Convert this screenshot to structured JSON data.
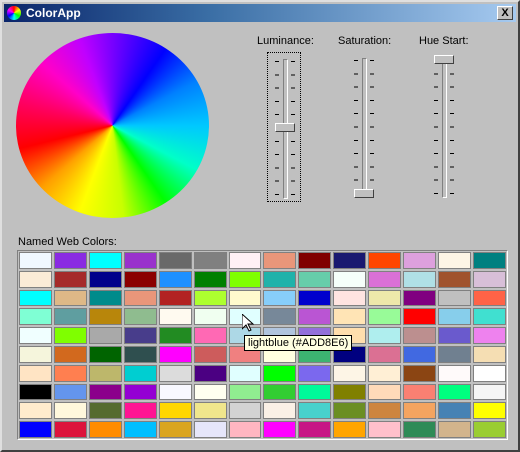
{
  "window": {
    "title": "ColorApp",
    "close_label": "X"
  },
  "sliders": [
    {
      "label": "Luminance:",
      "value": 0.5
    },
    {
      "label": "Saturation:",
      "value": 1.0
    },
    {
      "label": "Hue Start:",
      "value": 0.0
    }
  ],
  "named_colors": {
    "label": "Named Web Colors:",
    "tooltip": "lightblue (#ADD8E6)",
    "swatches": [
      "#f0f8ff",
      "#8a2be2",
      "#00ffff",
      "#9932cc",
      "#696969",
      "#808080",
      "#fff0f5",
      "#e9967a",
      "#800000",
      "#191970",
      "#ff4500",
      "#dda0dd",
      "#fdf5e6",
      "#008080",
      "#faebd7",
      "#a52a2a",
      "#00008b",
      "#8b0000",
      "#1e90ff",
      "#008000",
      "#7fff00",
      "#20b2aa",
      "#66cdaa",
      "#f5fffa",
      "#da70d6",
      "#b0e0e6",
      "#a0522d",
      "#d8bfd8",
      "#00ffff",
      "#deb887",
      "#008b8b",
      "#e9967a",
      "#b22222",
      "#adff2f",
      "#fffacd",
      "#87cefa",
      "#0000cd",
      "#ffe4e1",
      "#eee8aa",
      "#800080",
      "#c0c0c0",
      "#ff6347",
      "#7fffd4",
      "#5f9ea0",
      "#b8860b",
      "#8fbc8f",
      "#fffaf0",
      "#f0fff0",
      "#e0ffff",
      "#778899",
      "#ba55d3",
      "#ffe4b5",
      "#98fb98",
      "#ff0000",
      "#87ceeb",
      "#40e0d0",
      "#f0ffff",
      "#7fff00",
      "#a9a9a9",
      "#483d8b",
      "#228b22",
      "#ff69b4",
      "#add8e6",
      "#b0c4de",
      "#9370db",
      "#ffdead",
      "#afeeee",
      "#bc8f8f",
      "#6a5acd",
      "#ee82ee",
      "#f5f5dc",
      "#d2691e",
      "#006400",
      "#2f4f4f",
      "#ff00ff",
      "#cd5c5c",
      "#f08080",
      "#ffffe0",
      "#3cb371",
      "#000080",
      "#db7093",
      "#4169e1",
      "#708090",
      "#f5deb3",
      "#ffe4c4",
      "#ff7f50",
      "#bdb76b",
      "#00ced1",
      "#dcdcdc",
      "#4b0082",
      "#e0ffff",
      "#00ff00",
      "#7b68ee",
      "#fdf5e6",
      "#ffefd5",
      "#8b4513",
      "#fffafa",
      "#ffffff",
      "#000000",
      "#6495ed",
      "#8b008b",
      "#9400d3",
      "#f8f8ff",
      "#fffff0",
      "#90ee90",
      "#32cd32",
      "#00fa9a",
      "#808000",
      "#ffdab9",
      "#fa8072",
      "#00ff7f",
      "#f5f5f5",
      "#ffebcd",
      "#fff8dc",
      "#556b2f",
      "#ff1493",
      "#ffd700",
      "#f0e68c",
      "#d3d3d3",
      "#faf0e6",
      "#48d1cc",
      "#6b8e23",
      "#cd853f",
      "#f4a460",
      "#4682b4",
      "#ffff00",
      "#0000ff",
      "#dc143c",
      "#ff8c00",
      "#00bfff",
      "#daa520",
      "#e6e6fa",
      "#ffb6c1",
      "#ff00ff",
      "#c71585",
      "#ffa500",
      "#ffc0cb",
      "#2e8b57",
      "#d2b48c",
      "#9acd32"
    ]
  }
}
